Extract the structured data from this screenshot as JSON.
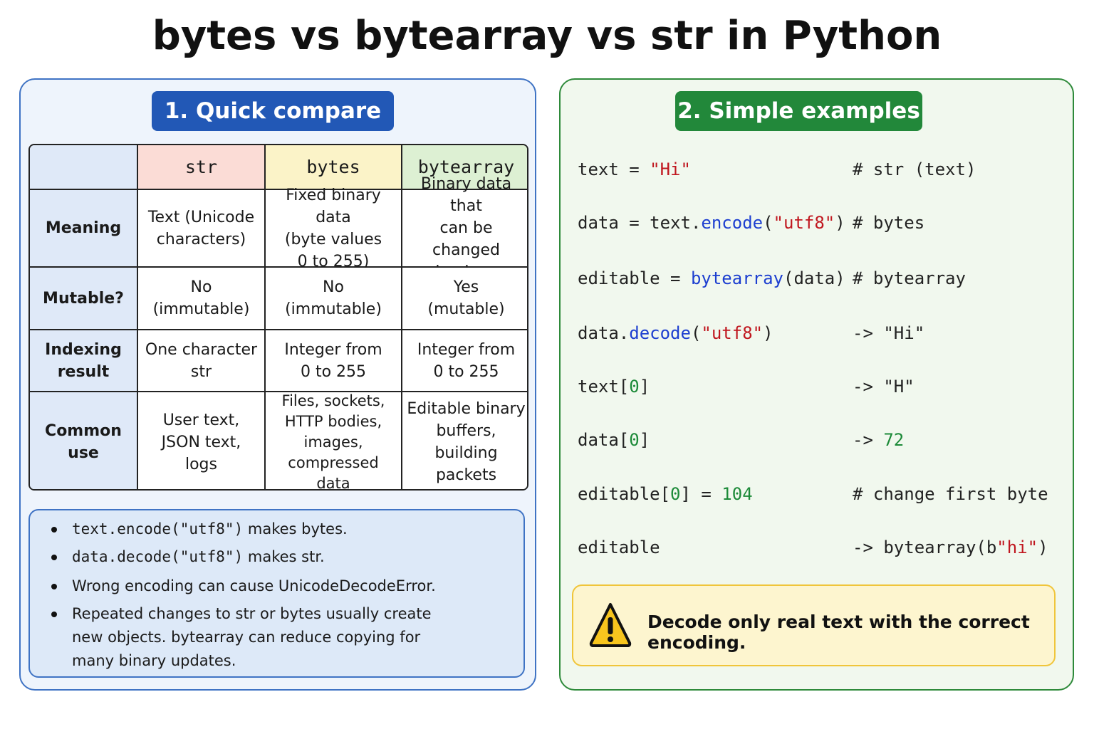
{
  "title": "bytes vs bytearray vs str in Python",
  "left_panel": {
    "heading": "1. Quick compare",
    "table": {
      "columns": [
        "str",
        "bytes",
        "bytearray"
      ],
      "column_colors": [
        "#fbdcd6",
        "#fbf3c8",
        "#ddf0d3"
      ],
      "rows": [
        {
          "label": "Meaning",
          "cells": [
            "Text (Unicode\ncharacters)",
            "Fixed binary data\n(byte values\n0 to 255)",
            "Binary data that\ncan be changed\nin place"
          ]
        },
        {
          "label": "Mutable?",
          "cells": [
            "No\n(immutable)",
            "No\n(immutable)",
            "Yes\n(mutable)"
          ]
        },
        {
          "label": "Indexing\nresult",
          "cells": [
            "One character\nstr",
            "Integer from\n0 to 255",
            "Integer from\n0 to 255"
          ]
        },
        {
          "label": "Common use",
          "cells": [
            "User text,\nJSON text,\nlogs",
            "Files, sockets,\nHTTP bodies,\nimages, compressed\ndata",
            "Editable binary\nbuffers, building\npackets"
          ]
        }
      ]
    },
    "notes": [
      {
        "code": "text.encode(\"utf8\")",
        "rest": " makes bytes."
      },
      {
        "code": "data.decode(\"utf8\")",
        "rest": " makes str."
      },
      {
        "code": "",
        "rest": "Wrong encoding can cause UnicodeDecodeError."
      },
      {
        "code": "",
        "rest": "Repeated changes to str or bytes usually create\nnew objects. bytearray can reduce copying for\nmany binary updates."
      }
    ]
  },
  "right_panel": {
    "heading": "2. Simple examples",
    "code_lines": [
      {
        "left": [
          [
            "text = ",
            "plain"
          ],
          [
            "\"Hi\"",
            "str"
          ]
        ],
        "right": [
          [
            "# str (text)",
            "plain"
          ]
        ]
      },
      {
        "left": [
          [
            "data = text.",
            "plain"
          ],
          [
            "encode",
            "kw"
          ],
          [
            "(",
            "plain"
          ],
          [
            "\"utf8\"",
            "str"
          ],
          [
            ")",
            "plain"
          ]
        ],
        "right": [
          [
            "# bytes",
            "plain"
          ]
        ]
      },
      {
        "left": [
          [
            "editable = ",
            "plain"
          ],
          [
            "bytearray",
            "kw"
          ],
          [
            "(data)",
            "plain"
          ]
        ],
        "right": [
          [
            "# bytearray",
            "plain"
          ]
        ]
      },
      {
        "left": [
          [
            "data.",
            "plain"
          ],
          [
            "decode",
            "kw"
          ],
          [
            "(",
            "plain"
          ],
          [
            "\"utf8\"",
            "str"
          ],
          [
            ")",
            "plain"
          ]
        ],
        "right": [
          [
            "-> \"Hi\"",
            "plain"
          ]
        ]
      },
      {
        "left": [
          [
            "text[",
            "plain"
          ],
          [
            "0",
            "num"
          ],
          [
            "]",
            "plain"
          ]
        ],
        "right": [
          [
            "-> \"H\"",
            "plain"
          ]
        ]
      },
      {
        "left": [
          [
            "data[",
            "plain"
          ],
          [
            "0",
            "num"
          ],
          [
            "]",
            "plain"
          ]
        ],
        "right": [
          [
            "-> ",
            "plain"
          ],
          [
            "72",
            "num"
          ]
        ]
      },
      {
        "left": [
          [
            "editable[",
            "plain"
          ],
          [
            "0",
            "num"
          ],
          [
            "] = ",
            "plain"
          ],
          [
            "104",
            "num"
          ]
        ],
        "right": [
          [
            "# change first byte",
            "plain"
          ]
        ]
      },
      {
        "left": [
          [
            "editable",
            "plain"
          ]
        ],
        "right": [
          [
            "-> bytearray(b",
            "plain"
          ],
          [
            "\"hi\"",
            "str"
          ],
          [
            ")",
            "plain"
          ]
        ]
      }
    ],
    "warning": {
      "icon": "warning-triangle-icon",
      "text": "Decode only real text with the correct encoding."
    }
  },
  "colors": {
    "left_border": "#3f73c4",
    "right_border": "#2e8a3a",
    "keyword": "#1d3fd0",
    "string": "#c0161e",
    "number": "#1c8a38"
  }
}
